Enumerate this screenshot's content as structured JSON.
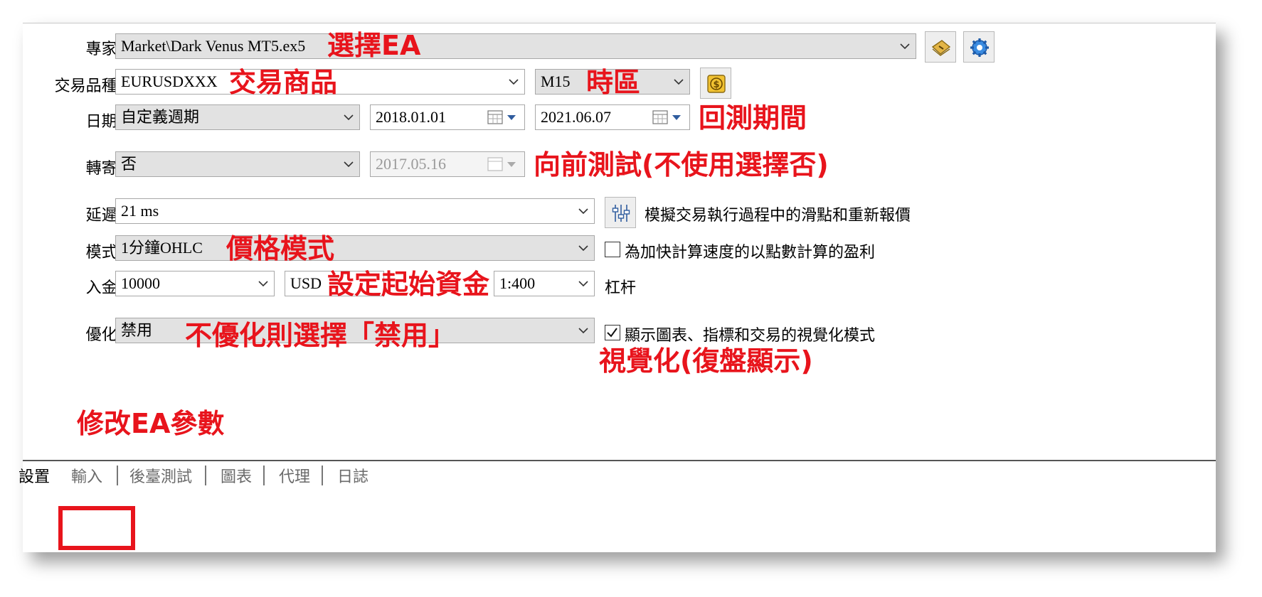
{
  "form": {
    "expert": {
      "label": "專家:",
      "value": "Market\\Dark Venus MT5.ex5"
    },
    "symbol": {
      "label": "交易品種:",
      "value": "EURUSDXXX",
      "timeframe": "M15"
    },
    "date": {
      "label": "日期:",
      "value": "自定義週期",
      "from": "2018.01.01",
      "to": "2021.06.07"
    },
    "forward": {
      "label": "轉寄:",
      "value": "否",
      "date": "2017.05.16"
    },
    "delay": {
      "label": "延遲:",
      "value": "21 ms",
      "note": "模擬交易執行過程中的滑點和重新報價"
    },
    "model": {
      "label": "模式:",
      "value": "1分鐘OHLC",
      "checkbox_label": "為加快計算速度的以點數計算的盈利",
      "checked": false
    },
    "deposit": {
      "label": "入金:",
      "value": "10000",
      "currency": "USD",
      "leverage": "1:400",
      "leverage_label": "杠杆"
    },
    "optimization": {
      "label": "優化:",
      "value": "禁用",
      "checkbox_label": "顯示圖表、指標和交易的視覺化模式",
      "checked": true
    }
  },
  "tabs": [
    "設置",
    "輸入",
    "後臺測試",
    "圖表",
    "代理",
    "日誌"
  ],
  "annotations": {
    "select_ea": "選擇EA",
    "trade_product": "交易商品",
    "timezone": "時區",
    "backtest_period": "回測期間",
    "forward_test": "向前測試(不使用選擇否)",
    "price_mode": "價格模式",
    "set_capital": "設定起始資金",
    "no_optimize": "不優化則選擇「禁用」",
    "visualization": "視覺化(復盤顯示)",
    "modify_params": "修改EA參數"
  },
  "colors": {
    "annotation": "#e8141c",
    "field_bg": "#e2e2e2"
  },
  "icons": [
    "expert-edit-icon",
    "settings-gear-icon",
    "symbol-properties-icon",
    "delay-sliders-icon",
    "calendar-icon",
    "chevron-down-icon"
  ]
}
